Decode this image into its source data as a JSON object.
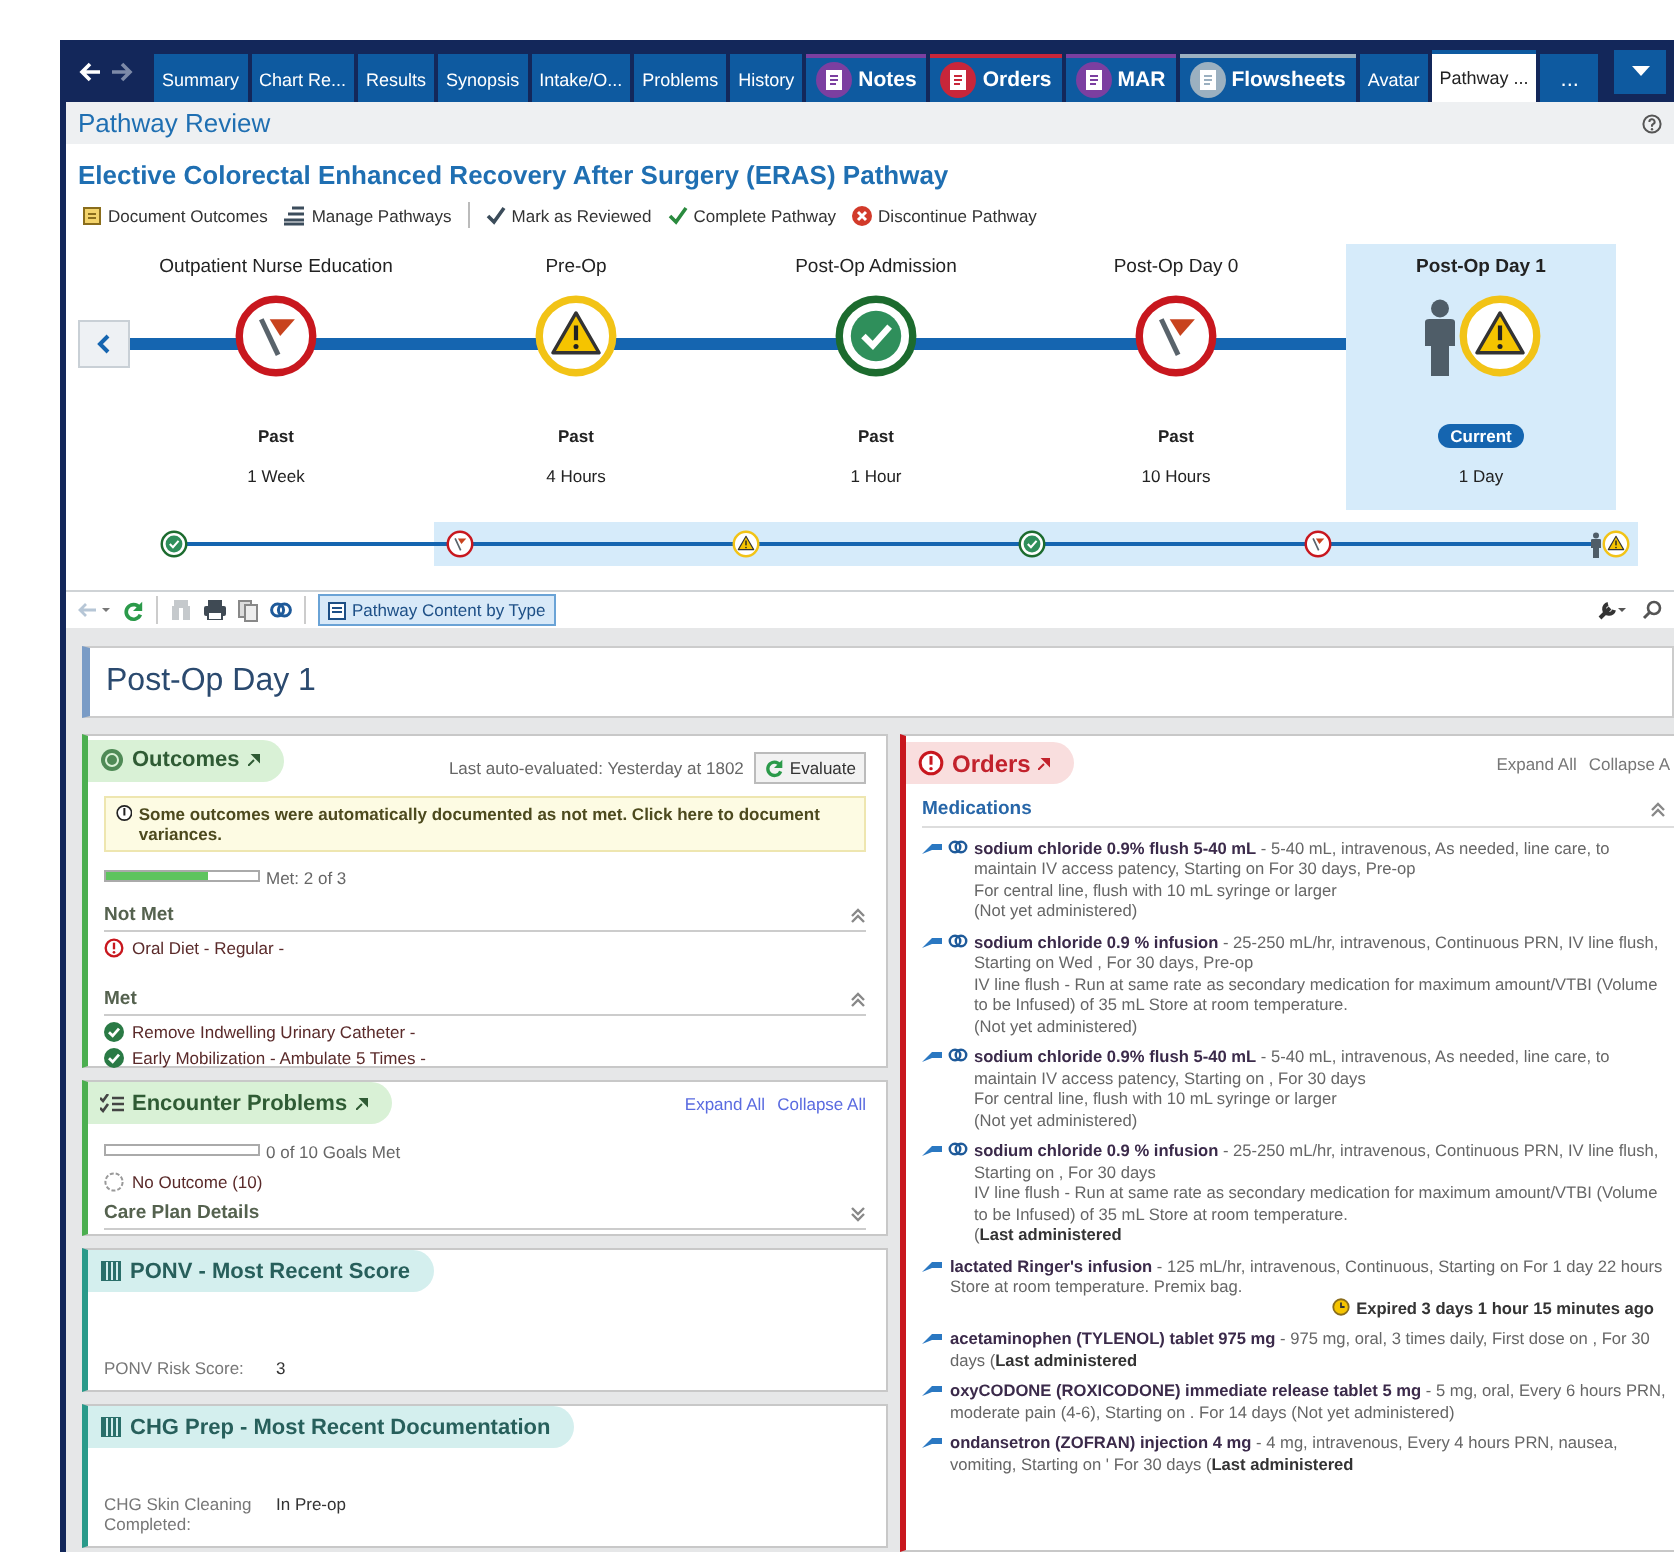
{
  "tabs": [
    {
      "label": "Summary",
      "kind": "plain",
      "selected": false
    },
    {
      "label": "Chart Re...",
      "kind": "plain",
      "selected": false
    },
    {
      "label": "Results",
      "kind": "plain",
      "selected": false
    },
    {
      "label": "Synopsis",
      "kind": "plain",
      "selected": false
    },
    {
      "label": "Intake/O...",
      "kind": "plain",
      "selected": false
    },
    {
      "label": "Problems",
      "kind": "plain",
      "selected": false
    },
    {
      "label": "History",
      "kind": "plain",
      "selected": false
    },
    {
      "label": "Notes",
      "kind": "notes",
      "selected": false
    },
    {
      "label": "Orders",
      "kind": "orders",
      "selected": false
    },
    {
      "label": "MAR",
      "kind": "mar",
      "selected": false
    },
    {
      "label": "Flowsheets",
      "kind": "flowsheets",
      "selected": false
    },
    {
      "label": "Avatar",
      "kind": "plain",
      "selected": false
    },
    {
      "label": "Pathway ...",
      "kind": "plain",
      "selected": true
    },
    {
      "label": "...",
      "kind": "more",
      "selected": false
    }
  ],
  "header": {
    "title": "Pathway Review",
    "pathway": "Elective Colorectal Enhanced Recovery After Surgery (ERAS) Pathway",
    "actions": [
      {
        "label": "Document Outcomes",
        "kind": "document"
      },
      {
        "label": "Manage Pathways",
        "kind": "manage"
      },
      {
        "label": "Mark as Reviewed",
        "kind": "review"
      },
      {
        "label": "Complete Pathway",
        "kind": "complete"
      },
      {
        "label": "Discontinue Pathway",
        "kind": "discontinue"
      }
    ]
  },
  "timeline": {
    "stages": [
      {
        "name": "Outpatient Nurse Education",
        "kind": "flag",
        "status": "Past",
        "time": "1 Week",
        "current": false
      },
      {
        "name": "Pre-Op",
        "kind": "warning",
        "status": "Past",
        "time": "4 Hours",
        "current": false
      },
      {
        "name": "Post-Op Admission",
        "kind": "check",
        "status": "Past",
        "time": "1 Hour",
        "current": false
      },
      {
        "name": "Post-Op Day 0",
        "kind": "flag",
        "status": "Past",
        "time": "10 Hours",
        "current": false
      },
      {
        "name": "Post-Op Day 1",
        "kind": "warning",
        "status": "Current",
        "time": "1 Day",
        "current": true
      }
    ],
    "overview": [
      {
        "kind": "check",
        "in_view": false,
        "current": false
      },
      {
        "kind": "flag",
        "in_view": true,
        "current": false
      },
      {
        "kind": "warning",
        "in_view": true,
        "current": false
      },
      {
        "kind": "check",
        "in_view": true,
        "current": false
      },
      {
        "kind": "flag",
        "in_view": true,
        "current": false
      },
      {
        "kind": "warning",
        "in_view": true,
        "current": true
      }
    ]
  },
  "content_toolbar": {
    "view_button": "Pathway Content by Type"
  },
  "phase_title": "Post-Op Day 1",
  "outcomes": {
    "title": "Outcomes",
    "last_evaluated": "Last auto-evaluated: Yesterday at 1802",
    "evaluate_button": "Evaluate",
    "alert": "Some outcomes were automatically documented as not met. Click here to document variances.",
    "level": 0.67,
    "progress_label": "Met: 2 of 3",
    "groups": [
      {
        "title": "Not Met",
        "items": [
          {
            "label": "Oral Diet - Regular -",
            "met": false
          }
        ]
      },
      {
        "title": "Met",
        "items": [
          {
            "label": "Remove Indwelling Urinary Catheter -",
            "met": true
          },
          {
            "label": "Early Mobilization - Ambulate 5 Times -",
            "met": true
          }
        ]
      }
    ]
  },
  "encounter_problems": {
    "title": "Encounter Problems",
    "links": [
      "Expand All",
      "Collapse All"
    ],
    "level": 0,
    "progress_label": "0 of 10 Goals Met",
    "no_outcome": "No Outcome (10)",
    "details": "Care Plan Details"
  },
  "score_cards": [
    {
      "title": "PONV - Most Recent Score",
      "rows": [
        {
          "label": "PONV Risk Score:",
          "value": "3"
        }
      ]
    },
    {
      "title": "CHG Prep - Most Recent Documentation",
      "rows": [
        {
          "label": "CHG Skin Cleaning Completed:",
          "value": "In Pre-op"
        }
      ]
    }
  ],
  "orders": {
    "title": "Orders",
    "links": [
      "Expand All",
      "Collapse A"
    ],
    "section": "Medications",
    "items": [
      {
        "name": "sodium chloride 0.9% flush 5-40 mL",
        "link": true,
        "details": "- 5-40 mL, intravenous, As needed, line care, to maintain IV access patency, Starting on For 30 days, Pre-op",
        "lines": [
          "For central line, flush with 10 mL syringe or larger",
          "(Not yet administered)"
        ]
      },
      {
        "name": "sodium chloride 0.9 % infusion",
        "link": true,
        "details": "- 25-250 mL/hr, intravenous, Continuous PRN, IV line flush, Starting on Wed , For 30 days, Pre-op",
        "lines": [
          "IV line flush - Run at same rate as secondary medication for maximum amount/VTBI (Volume to be Infused) of 35 mL Store at room temperature.",
          "(Not yet administered)"
        ]
      },
      {
        "name": "sodium chloride 0.9% flush 5-40 mL",
        "link": true,
        "details": "- 5-40 mL, intravenous, As needed, line care, to maintain IV access patency, Starting on , For 30 days",
        "lines": [
          "For central line, flush with 10 mL syringe or larger",
          "(Not yet administered)"
        ]
      },
      {
        "name": "sodium chloride 0.9 % infusion",
        "link": true,
        "details": "- 25-250 mL/hr, intravenous, Continuous PRN, IV line flush, Starting on , For 30 days",
        "lines": [
          "IV line flush - Run at same rate as secondary medication for maximum amount/VTBI (Volume to be Infused) of 35 mL Store at room temperature.",
          "(**Last administered**"
        ]
      },
      {
        "name": "lactated Ringer's infusion",
        "link": false,
        "details": "- 125 mL/hr, intravenous, Continuous, Starting on For 1 day 22 hours",
        "lines": [
          "Store at room temperature. Premix bag."
        ],
        "expired": "Expired 3 days 1 hour 15 minutes ago"
      },
      {
        "name": "acetaminophen (TYLENOL) tablet 975 mg",
        "link": false,
        "details": "- 975 mg, oral, 3 times daily, First dose on , For 30 days (**Last administered**"
      },
      {
        "name": "oxyCODONE (ROXICODONE) immediate release tablet 5 mg",
        "link": false,
        "details": "- 5 mg, oral, Every 6 hours PRN, moderate pain (4-6), Starting on . For 14 days (Not yet administered)"
      },
      {
        "name": "ondansetron (ZOFRAN) injection 4 mg",
        "link": false,
        "details": "- 4 mg, intravenous, Every 4 hours PRN, nausea, vomiting, Starting on ' For 30 days (**Last administered**"
      }
    ]
  }
}
